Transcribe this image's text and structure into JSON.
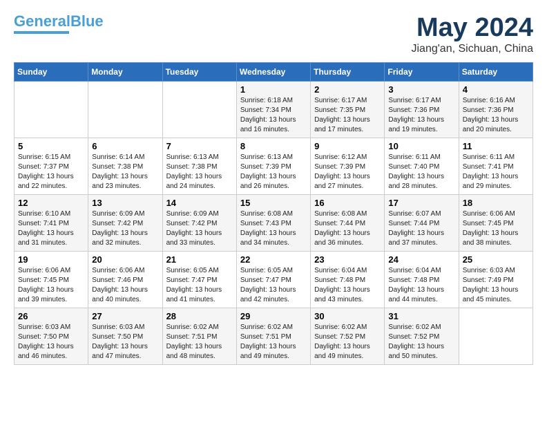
{
  "logo": {
    "general": "General",
    "blue": "Blue"
  },
  "title": "May 2024",
  "location": "Jiang'an, Sichuan, China",
  "days_header": [
    "Sunday",
    "Monday",
    "Tuesday",
    "Wednesday",
    "Thursday",
    "Friday",
    "Saturday"
  ],
  "weeks": [
    [
      {
        "num": "",
        "detail": ""
      },
      {
        "num": "",
        "detail": ""
      },
      {
        "num": "",
        "detail": ""
      },
      {
        "num": "1",
        "detail": "Sunrise: 6:18 AM\nSunset: 7:34 PM\nDaylight: 13 hours\nand 16 minutes."
      },
      {
        "num": "2",
        "detail": "Sunrise: 6:17 AM\nSunset: 7:35 PM\nDaylight: 13 hours\nand 17 minutes."
      },
      {
        "num": "3",
        "detail": "Sunrise: 6:17 AM\nSunset: 7:36 PM\nDaylight: 13 hours\nand 19 minutes."
      },
      {
        "num": "4",
        "detail": "Sunrise: 6:16 AM\nSunset: 7:36 PM\nDaylight: 13 hours\nand 20 minutes."
      }
    ],
    [
      {
        "num": "5",
        "detail": "Sunrise: 6:15 AM\nSunset: 7:37 PM\nDaylight: 13 hours\nand 22 minutes."
      },
      {
        "num": "6",
        "detail": "Sunrise: 6:14 AM\nSunset: 7:38 PM\nDaylight: 13 hours\nand 23 minutes."
      },
      {
        "num": "7",
        "detail": "Sunrise: 6:13 AM\nSunset: 7:38 PM\nDaylight: 13 hours\nand 24 minutes."
      },
      {
        "num": "8",
        "detail": "Sunrise: 6:13 AM\nSunset: 7:39 PM\nDaylight: 13 hours\nand 26 minutes."
      },
      {
        "num": "9",
        "detail": "Sunrise: 6:12 AM\nSunset: 7:39 PM\nDaylight: 13 hours\nand 27 minutes."
      },
      {
        "num": "10",
        "detail": "Sunrise: 6:11 AM\nSunset: 7:40 PM\nDaylight: 13 hours\nand 28 minutes."
      },
      {
        "num": "11",
        "detail": "Sunrise: 6:11 AM\nSunset: 7:41 PM\nDaylight: 13 hours\nand 29 minutes."
      }
    ],
    [
      {
        "num": "12",
        "detail": "Sunrise: 6:10 AM\nSunset: 7:41 PM\nDaylight: 13 hours\nand 31 minutes."
      },
      {
        "num": "13",
        "detail": "Sunrise: 6:09 AM\nSunset: 7:42 PM\nDaylight: 13 hours\nand 32 minutes."
      },
      {
        "num": "14",
        "detail": "Sunrise: 6:09 AM\nSunset: 7:42 PM\nDaylight: 13 hours\nand 33 minutes."
      },
      {
        "num": "15",
        "detail": "Sunrise: 6:08 AM\nSunset: 7:43 PM\nDaylight: 13 hours\nand 34 minutes."
      },
      {
        "num": "16",
        "detail": "Sunrise: 6:08 AM\nSunset: 7:44 PM\nDaylight: 13 hours\nand 36 minutes."
      },
      {
        "num": "17",
        "detail": "Sunrise: 6:07 AM\nSunset: 7:44 PM\nDaylight: 13 hours\nand 37 minutes."
      },
      {
        "num": "18",
        "detail": "Sunrise: 6:06 AM\nSunset: 7:45 PM\nDaylight: 13 hours\nand 38 minutes."
      }
    ],
    [
      {
        "num": "19",
        "detail": "Sunrise: 6:06 AM\nSunset: 7:45 PM\nDaylight: 13 hours\nand 39 minutes."
      },
      {
        "num": "20",
        "detail": "Sunrise: 6:06 AM\nSunset: 7:46 PM\nDaylight: 13 hours\nand 40 minutes."
      },
      {
        "num": "21",
        "detail": "Sunrise: 6:05 AM\nSunset: 7:47 PM\nDaylight: 13 hours\nand 41 minutes."
      },
      {
        "num": "22",
        "detail": "Sunrise: 6:05 AM\nSunset: 7:47 PM\nDaylight: 13 hours\nand 42 minutes."
      },
      {
        "num": "23",
        "detail": "Sunrise: 6:04 AM\nSunset: 7:48 PM\nDaylight: 13 hours\nand 43 minutes."
      },
      {
        "num": "24",
        "detail": "Sunrise: 6:04 AM\nSunset: 7:48 PM\nDaylight: 13 hours\nand 44 minutes."
      },
      {
        "num": "25",
        "detail": "Sunrise: 6:03 AM\nSunset: 7:49 PM\nDaylight: 13 hours\nand 45 minutes."
      }
    ],
    [
      {
        "num": "26",
        "detail": "Sunrise: 6:03 AM\nSunset: 7:50 PM\nDaylight: 13 hours\nand 46 minutes."
      },
      {
        "num": "27",
        "detail": "Sunrise: 6:03 AM\nSunset: 7:50 PM\nDaylight: 13 hours\nand 47 minutes."
      },
      {
        "num": "28",
        "detail": "Sunrise: 6:02 AM\nSunset: 7:51 PM\nDaylight: 13 hours\nand 48 minutes."
      },
      {
        "num": "29",
        "detail": "Sunrise: 6:02 AM\nSunset: 7:51 PM\nDaylight: 13 hours\nand 49 minutes."
      },
      {
        "num": "30",
        "detail": "Sunrise: 6:02 AM\nSunset: 7:52 PM\nDaylight: 13 hours\nand 49 minutes."
      },
      {
        "num": "31",
        "detail": "Sunrise: 6:02 AM\nSunset: 7:52 PM\nDaylight: 13 hours\nand 50 minutes."
      },
      {
        "num": "",
        "detail": ""
      }
    ]
  ]
}
